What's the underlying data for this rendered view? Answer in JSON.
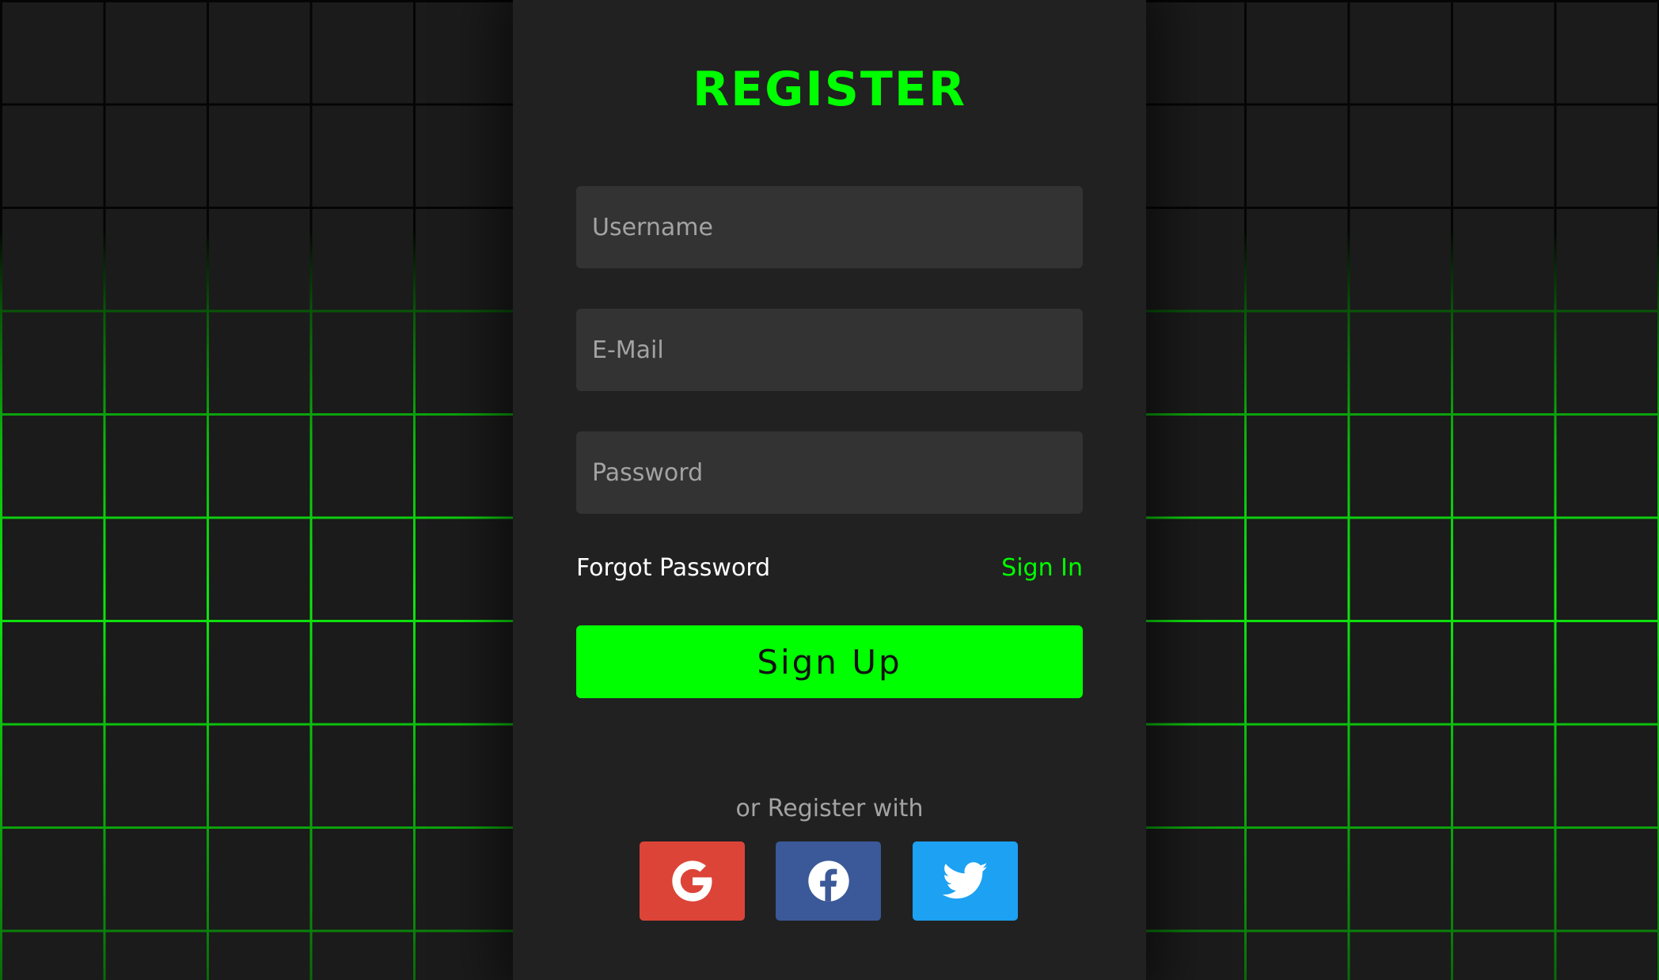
{
  "form": {
    "title": "REGISTER",
    "username_placeholder": "Username",
    "email_placeholder": "E-Mail",
    "password_placeholder": "Password",
    "forgot_label": "Forgot Password",
    "signin_label": "Sign In",
    "signup_label": "Sign Up",
    "or_text": "or Register with"
  },
  "social": [
    {
      "icon": "google-icon",
      "color": "#dd4438"
    },
    {
      "icon": "facebook-icon",
      "color": "#3b5998"
    },
    {
      "icon": "twitter-icon",
      "color": "#1da1f2"
    }
  ],
  "theme": {
    "accent": "#00ff00",
    "panel": "#212121",
    "field": "#333333",
    "background": "#1b1b1b"
  }
}
